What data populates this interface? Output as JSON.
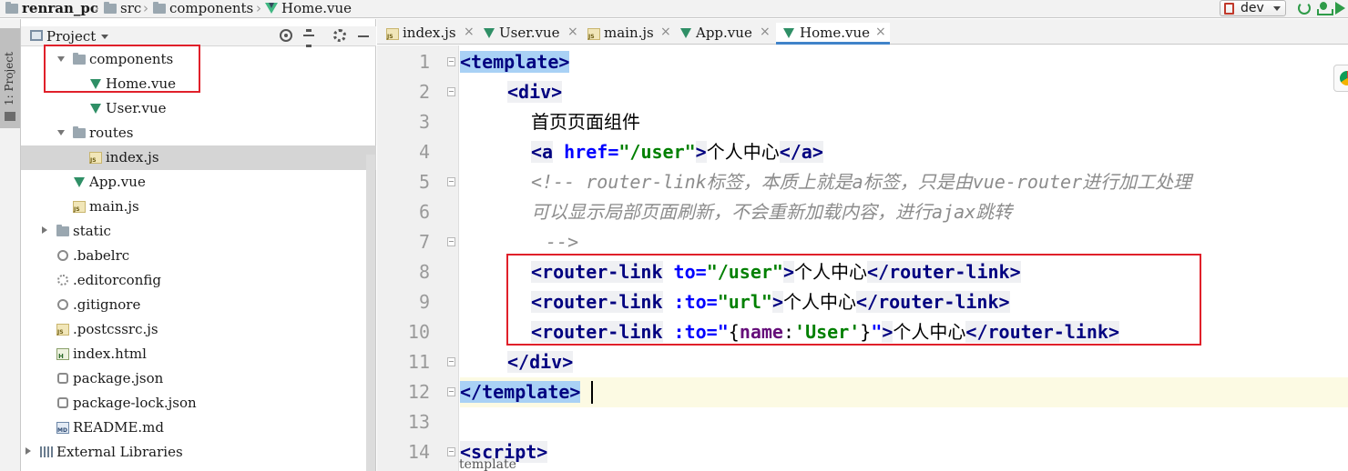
{
  "breadcrumb": {
    "project": "renran_pc",
    "folder1": "src",
    "folder2": "components",
    "file": "Home.vue"
  },
  "toolbar": {
    "branch": "dev",
    "icons": [
      "refresh-icon",
      "build-icon",
      "run-icon"
    ]
  },
  "left_strip": {
    "label": "1: Project"
  },
  "project_panel": {
    "header": "Project",
    "tree": [
      {
        "label": "components",
        "icon": "folder-icon",
        "expanded": true
      },
      {
        "label": "Home.vue",
        "icon": "vue-file-icon"
      },
      {
        "label": "User.vue",
        "icon": "vue-file-icon"
      },
      {
        "label": "routes",
        "icon": "folder-icon",
        "expanded": true
      },
      {
        "label": "index.js",
        "icon": "js-file-icon",
        "selected": true
      },
      {
        "label": "App.vue",
        "icon": "vue-file-icon"
      },
      {
        "label": "main.js",
        "icon": "js-file-icon"
      },
      {
        "label": "static",
        "icon": "folder-icon",
        "expanded": false
      },
      {
        "label": ".babelrc",
        "icon": "config-file-icon"
      },
      {
        "label": ".editorconfig",
        "icon": "gear-icon"
      },
      {
        "label": ".gitignore",
        "icon": "config-file-icon"
      },
      {
        "label": ".postcssrc.js",
        "icon": "js-file-icon"
      },
      {
        "label": "index.html",
        "icon": "html-file-icon"
      },
      {
        "label": "package.json",
        "icon": "json-file-icon"
      },
      {
        "label": "package-lock.json",
        "icon": "json-file-icon"
      },
      {
        "label": "README.md",
        "icon": "md-file-icon"
      },
      {
        "label": "External Libraries",
        "icon": "library-icon",
        "expanded": false
      }
    ]
  },
  "editor": {
    "tabs": [
      {
        "label": "index.js",
        "icon": "js-file-icon"
      },
      {
        "label": "User.vue",
        "icon": "vue-file-icon"
      },
      {
        "label": "main.js",
        "icon": "js-file-icon"
      },
      {
        "label": "App.vue",
        "icon": "vue-file-icon"
      },
      {
        "label": "Home.vue",
        "icon": "vue-file-icon",
        "active": true
      }
    ],
    "tab_close": "×",
    "line_numbers": [
      "1",
      "2",
      "3",
      "4",
      "5",
      "6",
      "7",
      "8",
      "9",
      "10",
      "11",
      "12",
      "13",
      "14"
    ],
    "current_line": "12",
    "code": {
      "l1": {
        "t1": "<template>"
      },
      "l2": {
        "t1": "<div>"
      },
      "l3": {
        "text": "首页页面组件"
      },
      "l4": {
        "t1": "<a",
        "a1": "href",
        "eq": "=",
        "s1": "\"/user\"",
        "t2": ">",
        "text": "个人中心",
        "t3": "</a>"
      },
      "l5": {
        "text": "<!-- router-link标签，本质上就是a标签，只是由vue-router进行加工处理"
      },
      "l6": {
        "text": "可以显示局部页面刷新，不会重新加载内容，进行ajax跳转"
      },
      "l7": {
        "text": "-->"
      },
      "l8": {
        "t1": "<router-link",
        "a1": "to",
        "eq": "=",
        "s1": "\"/user\"",
        "t2": ">",
        "text": "个人中心",
        "t3": "</router-link>"
      },
      "l9": {
        "t1": "<router-link",
        "a1": ":to",
        "eq": "=",
        "s1": "\"url\"",
        "t2": ">",
        "text": "个人中心",
        "t3": "</router-link>"
      },
      "l10": {
        "t1": "<router-link",
        "a1": ":to",
        "eq": "=",
        "q1": "\"",
        "b1": "{",
        "p1": "name",
        "c1": ":",
        "s1": "'User'",
        "b2": "}",
        "q2": "\"",
        "t2": ">",
        "text": "个人中心",
        "t3": "</router-link>"
      },
      "l11": {
        "t1": "</div>"
      },
      "l12": {
        "t1": "</template>"
      },
      "l14": {
        "t1": "<script>"
      }
    },
    "bottom_breadcrumb": "template",
    "side_icon": "chrome-icon"
  },
  "colors": {
    "highlight_box": "#e0202a",
    "tag": "#000080",
    "attribute": "#0000ff",
    "string": "#008000",
    "comment": "#8c8c8c",
    "selected_row": "#d5d5d5",
    "template_tag_highlight": "#a9d1f5"
  }
}
